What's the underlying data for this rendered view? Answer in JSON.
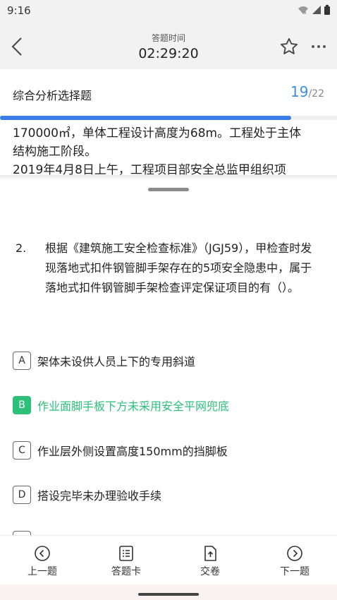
{
  "status_bar": {
    "time": "9:16"
  },
  "header": {
    "timer_caption": "答题时间",
    "timer_value": "02:29:20"
  },
  "section": {
    "title": "综合分析选择题",
    "current": "19",
    "total": "/22",
    "progress": 0.864
  },
  "passage": {
    "lines": [
      "170000㎡，单体工程设计高度为68m。工程处于主体",
      "结构施工阶段。",
      "2019年4月8日上午，工程项目部安全总监甲组织项"
    ]
  },
  "question": {
    "number": "2.",
    "text": "根据《建筑施工安全检查标准》（JGJ59），甲检查时发现落地式扣件钢管脚手架存在的5项安全隐患中，属于落地式扣件钢管脚手架检查评定保证项目的有（）。"
  },
  "options": [
    {
      "letter": "A",
      "text": "架体未设供人员上下的专用斜道",
      "selected": false
    },
    {
      "letter": "B",
      "text": "作业面脚手板下方未采用安全平网兜底",
      "selected": true
    },
    {
      "letter": "C",
      "text": "作业层外侧设置高度150mm的挡脚板",
      "selected": false
    },
    {
      "letter": "D",
      "text": "搭设完毕未办理验收手续",
      "selected": false
    }
  ],
  "bottom_nav": {
    "prev": "上一题",
    "answer_card": "答题卡",
    "submit": "交卷",
    "next": "下一题"
  },
  "colors": {
    "accent_blue": "#3b7de8",
    "selected_green": "#2cc079"
  }
}
